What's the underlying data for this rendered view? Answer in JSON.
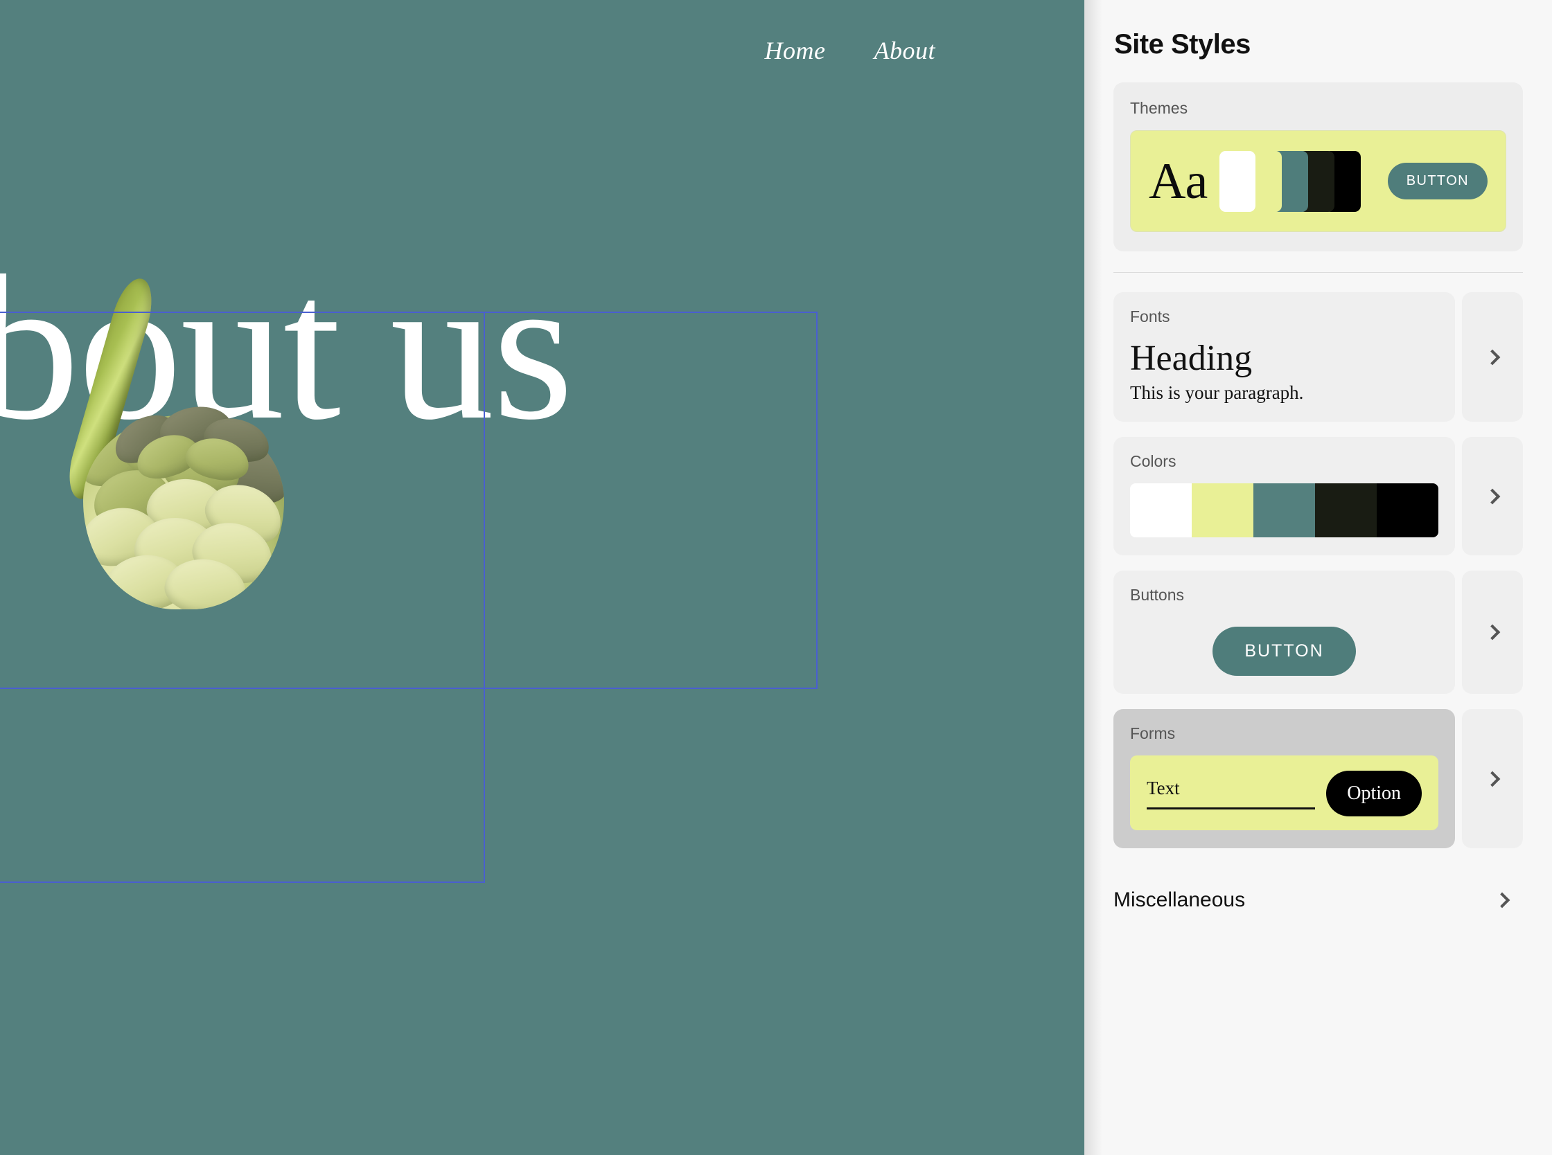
{
  "panel": {
    "title": "Site Styles",
    "themes": {
      "label": "Themes",
      "preview_text": "Aa",
      "button_label": "BUTTON",
      "swatches": [
        "#ffffff",
        "#e9f096",
        "#4f7d7b",
        "#191c13",
        "#000000"
      ],
      "background": "#e9f096"
    },
    "fonts": {
      "label": "Fonts",
      "heading_sample": "Heading",
      "paragraph_sample": "This is your paragraph.",
      "chevron_icon": "chevron-right-icon"
    },
    "colors": {
      "label": "Colors",
      "swatches": [
        "#ffffff",
        "#e9f096",
        "#54807e",
        "#191c13",
        "#000000"
      ],
      "chevron_icon": "chevron-right-icon"
    },
    "buttons": {
      "label": "Buttons",
      "button_label": "BUTTON",
      "button_color": "#4f7d7b",
      "chevron_icon": "chevron-right-icon"
    },
    "forms": {
      "label": "Forms",
      "field_text": "Text",
      "option_label": "Option",
      "field_background": "#e9f096",
      "option_color": "#000000",
      "chevron_icon": "chevron-right-icon",
      "selected": true
    },
    "miscellaneous": {
      "label": "Miscellaneous",
      "chevron_icon": "chevron-right-icon"
    }
  },
  "canvas": {
    "background": "#54807e",
    "nav": [
      {
        "label": "Home"
      },
      {
        "label": "About"
      }
    ],
    "hero_text": "About us",
    "guide_color": "#4a5fd0",
    "image_alt": "artichoke"
  }
}
